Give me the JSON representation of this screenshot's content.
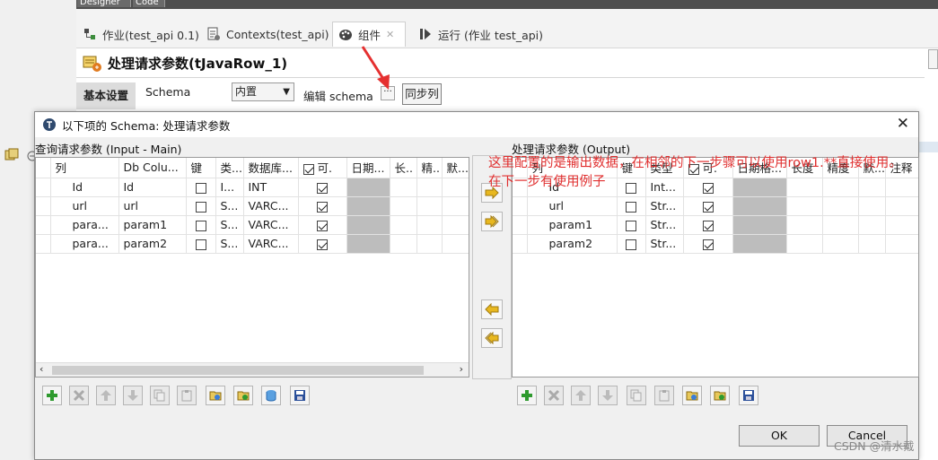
{
  "top_strip_tabs": [
    "Designer",
    "Code"
  ],
  "editor_tabs": [
    {
      "label": "作业(test_api 0.1)",
      "active": false
    },
    {
      "label": "Contexts(test_api)",
      "active": false
    },
    {
      "label": "组件",
      "active": true
    },
    {
      "label": "运行 (作业 test_api)",
      "active": false
    }
  ],
  "component": {
    "title": "处理请求参数(tJavaRow_1)",
    "basic_settings_tab": "基本设置",
    "schema_label": "Schema",
    "schema_value": "内置",
    "edit_schema_label": "编辑 schema",
    "dots_label": "···",
    "sync_columns_label": "同步列"
  },
  "dialog": {
    "title": "以下项的 Schema: 处理请求参数",
    "close": "✕",
    "input_panel_label": "查询请求参数 (Input - Main)",
    "output_panel_label": "处理请求参数 (Output)",
    "input_table": {
      "headers": [
        "列",
        "Db Colu...",
        "键",
        "类...",
        "数据库...",
        "可.",
        "日期...",
        "长..",
        "精..",
        "默..."
      ],
      "rows": [
        {
          "col": "Id",
          "db": "Id",
          "key": false,
          "type": "I...",
          "dbtype": "INT",
          "nullable": true
        },
        {
          "col": "url",
          "db": "url",
          "key": false,
          "type": "S...",
          "dbtype": "VARC...",
          "nullable": true
        },
        {
          "col": "para...",
          "db": "param1",
          "key": false,
          "type": "S...",
          "dbtype": "VARC...",
          "nullable": true
        },
        {
          "col": "para...",
          "db": "param2",
          "key": false,
          "type": "S...",
          "dbtype": "VARC...",
          "nullable": true
        }
      ]
    },
    "output_table": {
      "headers": [
        "列",
        "键",
        "类型",
        "可.",
        "日期格...",
        "长度",
        "精度",
        "默...",
        "注释"
      ],
      "rows": [
        {
          "col": "Id",
          "key": false,
          "type": "Int...",
          "nullable": true
        },
        {
          "col": "url",
          "key": false,
          "type": "Str...",
          "nullable": true
        },
        {
          "col": "param1",
          "key": false,
          "type": "Str...",
          "nullable": true
        },
        {
          "col": "param2",
          "key": false,
          "type": "Str...",
          "nullable": true
        }
      ]
    },
    "ok_label": "OK",
    "cancel_label": "Cancel"
  },
  "annotation": "这里配置的是输出数据，在相邻的下一步骤可以使用row1.**直接使用。在下一步有使用例子",
  "watermark": "CSDN @清水戴",
  "colors": {
    "annotation_red": "#e02f2f",
    "arrow_red": "#e53030",
    "grey_cell": "#bdbdbd",
    "green_plus": "#2e9a2e",
    "yellow_arrow": "#e8b820"
  }
}
